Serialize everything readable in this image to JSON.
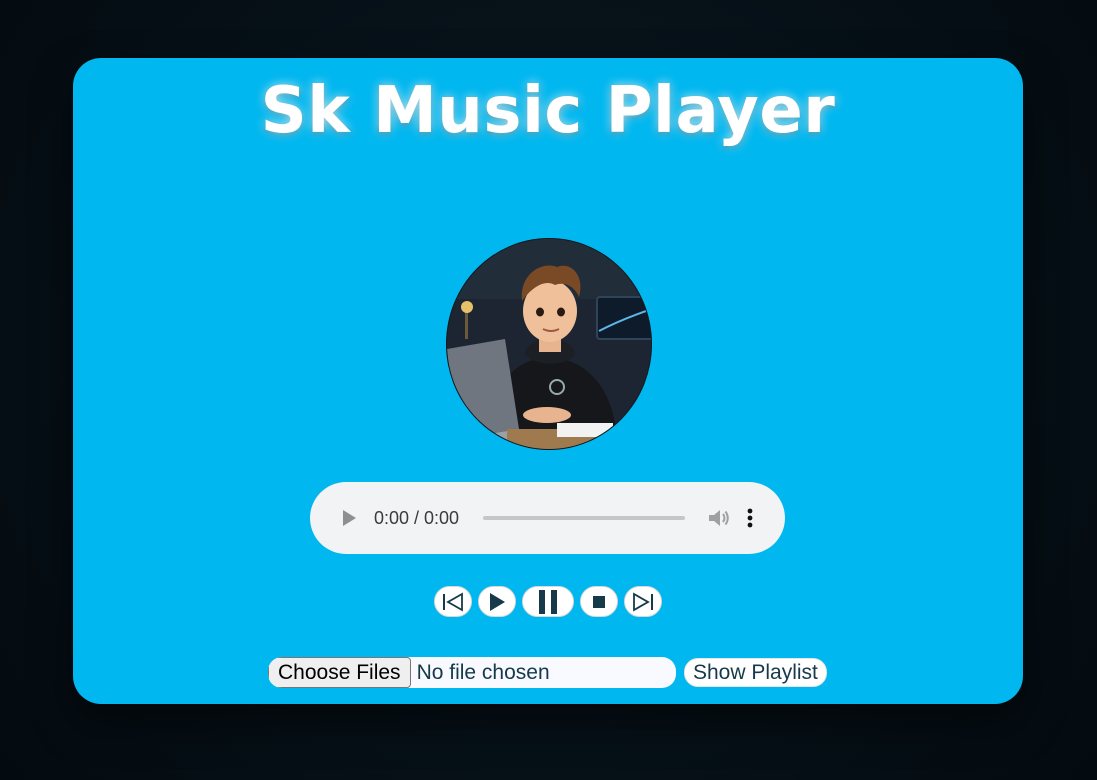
{
  "app": {
    "title": "Sk Music Player"
  },
  "player": {
    "time": "0:00 / 0:00",
    "progress_fraction": 0
  },
  "controls": [
    {
      "name": "previous-button",
      "icon": "skip-previous-icon"
    },
    {
      "name": "play-button",
      "icon": "play-icon"
    },
    {
      "name": "pause-button",
      "icon": "pause-icon"
    },
    {
      "name": "stop-button",
      "icon": "stop-icon"
    },
    {
      "name": "next-button",
      "icon": "skip-next-icon"
    }
  ],
  "file_picker": {
    "button_label": "Choose Files",
    "status": "No file chosen"
  },
  "playlist": {
    "button_label": "Show Playlist"
  },
  "colors": {
    "card": "#00b7ef",
    "background": "#061017",
    "control_icon": "#163a4a"
  }
}
